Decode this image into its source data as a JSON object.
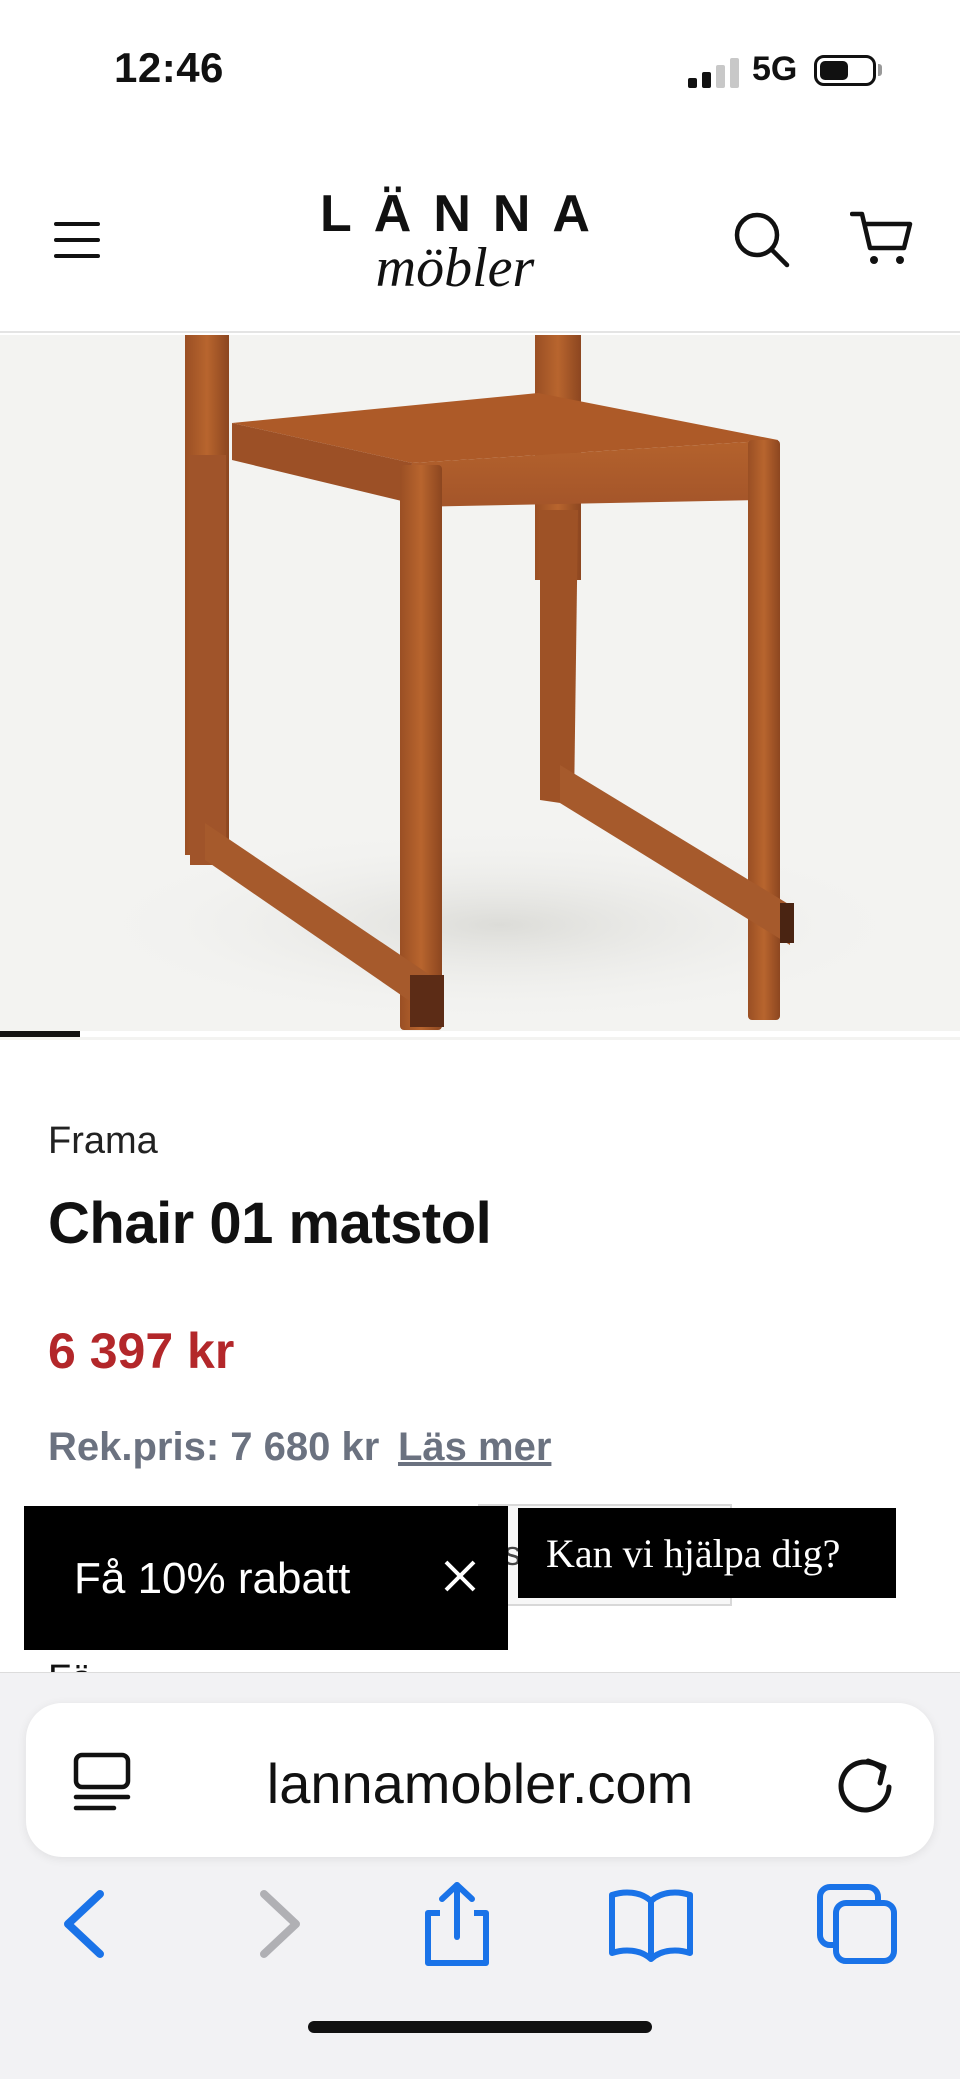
{
  "status_bar": {
    "time": "12:46",
    "network": "5G"
  },
  "header": {
    "logo_top": "LÄNNA",
    "logo_bottom": "möbler"
  },
  "product": {
    "brand": "Frama",
    "title": "Chair 01 matstol",
    "price": "6 397 kr",
    "rek_price": "Rek.pris: 7 680 kr",
    "read_more": "Läs mer"
  },
  "promo": {
    "label": "Få 10% rabatt",
    "close_symbol": "✕"
  },
  "hidden_fragment": "s",
  "help": {
    "label": "Kan vi hjälpa dig?"
  },
  "cut_off_text": "Fä",
  "browser": {
    "url": "lannamobler.com"
  },
  "colors": {
    "price": "#b3272a",
    "muted": "#6b7280",
    "ios_blue": "#1a73e8"
  },
  "icons": [
    "menu-icon",
    "search-icon",
    "cart-icon",
    "tab-overview-icon",
    "reload-icon",
    "back-icon",
    "forward-icon",
    "share-icon",
    "bookmarks-icon",
    "tabs-icon"
  ]
}
